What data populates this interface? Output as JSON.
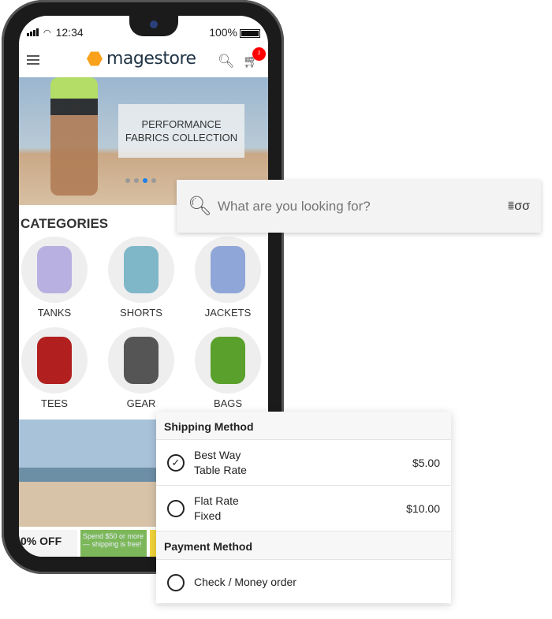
{
  "status": {
    "time": "12:34",
    "battery": "100%"
  },
  "appbar": {
    "logo": "magestore",
    "cart_count": "2"
  },
  "hero": {
    "title_line1": "PERFORMANCE",
    "title_line2": "FABRICS COLLECTION",
    "slides": 4,
    "active_slide": 3
  },
  "categories": {
    "heading": "CATEGORIES",
    "items": [
      {
        "label": "TANKS",
        "color": "#b8b0e0"
      },
      {
        "label": "SHORTS",
        "color": "#7fb7c9"
      },
      {
        "label": "JACKETS",
        "color": "#8fa6d8"
      },
      {
        "label": "TEES",
        "color": "#b11f1f"
      },
      {
        "label": "GEAR",
        "color": "#555555"
      },
      {
        "label": "BAGS",
        "color": "#5aa02c"
      }
    ]
  },
  "promos": {
    "p1": "0% OFF",
    "p2": "Spend $50 or more — shipping is free!"
  },
  "search": {
    "placeholder": "What are you looking for?"
  },
  "checkout": {
    "shipping_heading": "Shipping Method",
    "options": [
      {
        "line1": "Best Way",
        "line2": "Table Rate",
        "price": "$5.00",
        "selected": true
      },
      {
        "line1": "Flat Rate",
        "line2": "Fixed",
        "price": "$10.00",
        "selected": false
      }
    ],
    "payment_heading": "Payment Method",
    "payment": [
      {
        "label": "Check / Money order",
        "selected": false
      }
    ]
  }
}
